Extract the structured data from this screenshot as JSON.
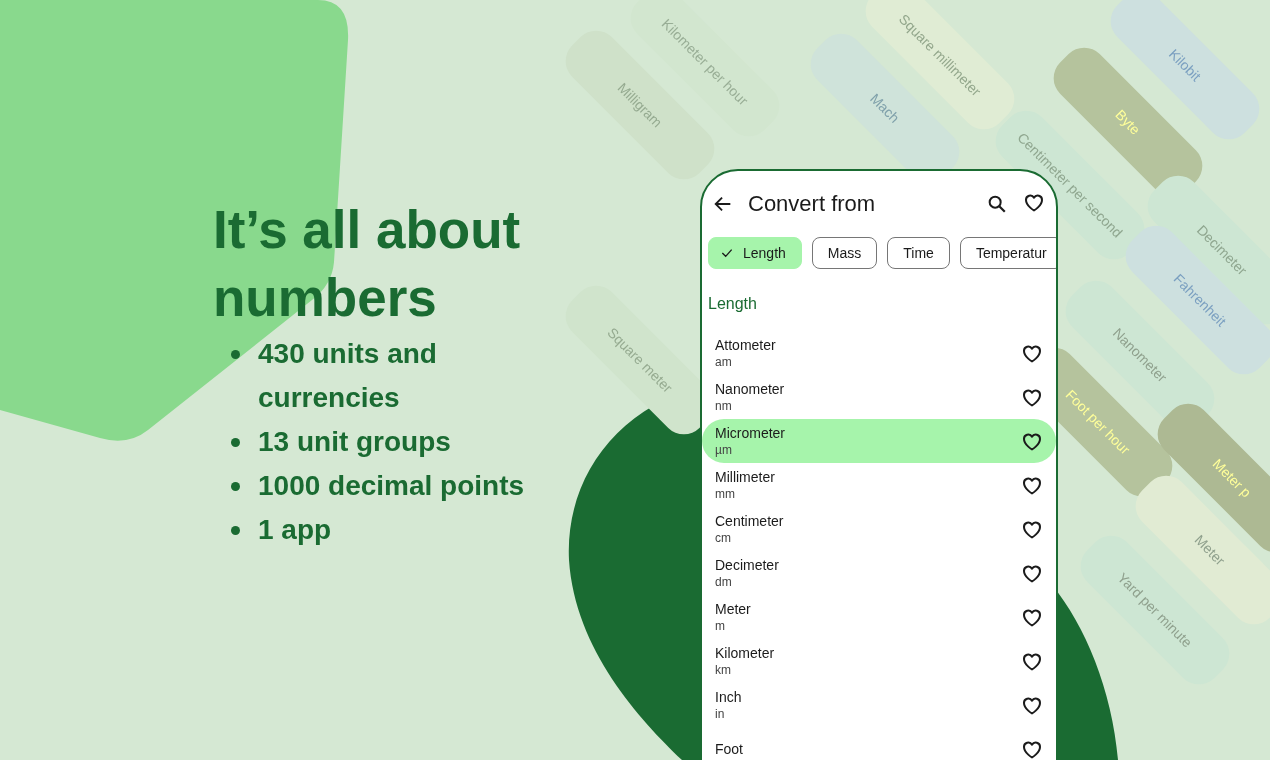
{
  "headline": "It’s all about numbers",
  "bullets": [
    "430 units and currencies",
    "13 unit groups",
    "1000 decimal points",
    "1 app"
  ],
  "background_tags": [
    {
      "label": "Kilometer per hour",
      "color": "#d2e6cf"
    },
    {
      "label": "Milligram",
      "color": "#cfe1c9"
    },
    {
      "label": "Square millimeter",
      "color": "#e0ecd4"
    },
    {
      "label": "Mach",
      "color": "#cfe3da"
    },
    {
      "label": "Kilobit",
      "color": "#cde0df"
    },
    {
      "label": "Byte",
      "color": "#b5c39d"
    },
    {
      "label": "Centimeter per second",
      "color": "#cde6d3"
    },
    {
      "label": "Decimeter",
      "color": "#cde6d3"
    },
    {
      "label": "Fahrenheit",
      "color": "#cde0df"
    },
    {
      "label": "Nanometer",
      "color": "#cde6d3"
    },
    {
      "label": "Foot per hour",
      "color": "#b5c39d"
    },
    {
      "label": "Meter p",
      "color": "#adb993"
    },
    {
      "label": "Meter",
      "color": "#e1ebd3"
    },
    {
      "label": "Yard per minute",
      "color": "#cde6d3"
    },
    {
      "label": "Square meter",
      "color": "#d0e4cc"
    }
  ],
  "screen": {
    "title": "Convert from",
    "chips": [
      {
        "label": "Length",
        "selected": true
      },
      {
        "label": "Mass",
        "selected": false
      },
      {
        "label": "Time",
        "selected": false
      },
      {
        "label": "Temperatur",
        "selected": false
      }
    ],
    "section": "Length",
    "units": [
      {
        "name": "Attometer",
        "symbol": "am",
        "selected": false
      },
      {
        "name": "Nanometer",
        "symbol": "nm",
        "selected": false
      },
      {
        "name": "Micrometer",
        "symbol": "µm",
        "selected": true
      },
      {
        "name": "Millimeter",
        "symbol": "mm",
        "selected": false
      },
      {
        "name": "Centimeter",
        "symbol": "cm",
        "selected": false
      },
      {
        "name": "Decimeter",
        "symbol": "dm",
        "selected": false
      },
      {
        "name": "Meter",
        "symbol": "m",
        "selected": false
      },
      {
        "name": "Kilometer",
        "symbol": "km",
        "selected": false
      },
      {
        "name": "Inch",
        "symbol": "in",
        "selected": false
      },
      {
        "name": "Foot",
        "selected": false
      }
    ]
  }
}
